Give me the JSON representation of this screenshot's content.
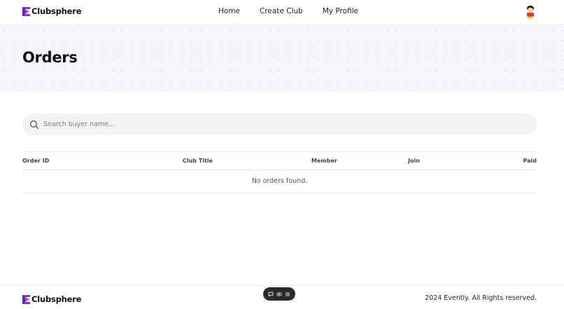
{
  "header": {
    "brand": "Clubsphere",
    "nav": [
      "Home",
      "Create Club",
      "My Profile"
    ]
  },
  "hero": {
    "title": "Orders"
  },
  "search": {
    "placeholder": "Search buyer name..."
  },
  "table": {
    "columns": [
      "Order ID",
      "Club Title",
      "Member",
      "Join",
      "Paid"
    ],
    "empty_message": "No orders found."
  },
  "footer": {
    "brand": "Clubsphere",
    "copyright": "2024 Evently. All Rights reserved."
  },
  "colors": {
    "logo_primary": "#6a3df0",
    "logo_accent": "#e8357a",
    "hero_bg": "#f5f6fb"
  }
}
